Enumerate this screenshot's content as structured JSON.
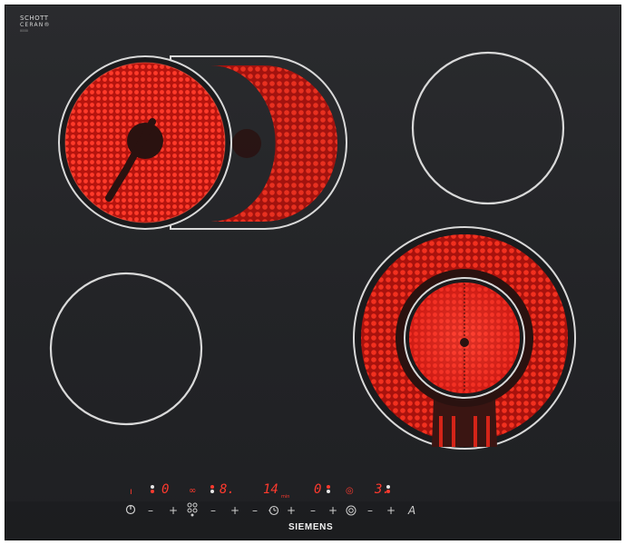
{
  "logo": {
    "line1": "SCHOTT",
    "line2": "CERAN®",
    "line3": "0000"
  },
  "brand": "SIEMENS",
  "zones": {
    "back_left": {
      "state": "on",
      "color": "#e8261c"
    },
    "back_left_extension": {
      "state": "on",
      "color": "#d82419"
    },
    "back_right": {
      "state": "off"
    },
    "front_left": {
      "state": "off"
    },
    "front_right": {
      "state": "on",
      "color": "#f02a1e"
    }
  },
  "displays": {
    "zone1_level": "0",
    "zone2_level": "8.",
    "timer": "14",
    "timer_unit": "min",
    "zone3_level": "0",
    "zone4_level": "3."
  },
  "controls": {
    "power_icon": "power-icon",
    "minus": "–",
    "plus": "+",
    "timer_minus": "–",
    "timer_plus": "+",
    "lock": "A",
    "zone_select_icon": "zone-select-icon",
    "extension_icon": "extension-icon",
    "clock_icon": "clock-icon",
    "dual_ring_icon": "dual-ring-icon"
  },
  "colors": {
    "glass": "#242528",
    "heat": "#e8261c",
    "display": "#ff3a2e",
    "ring": "#d9d9d9"
  }
}
